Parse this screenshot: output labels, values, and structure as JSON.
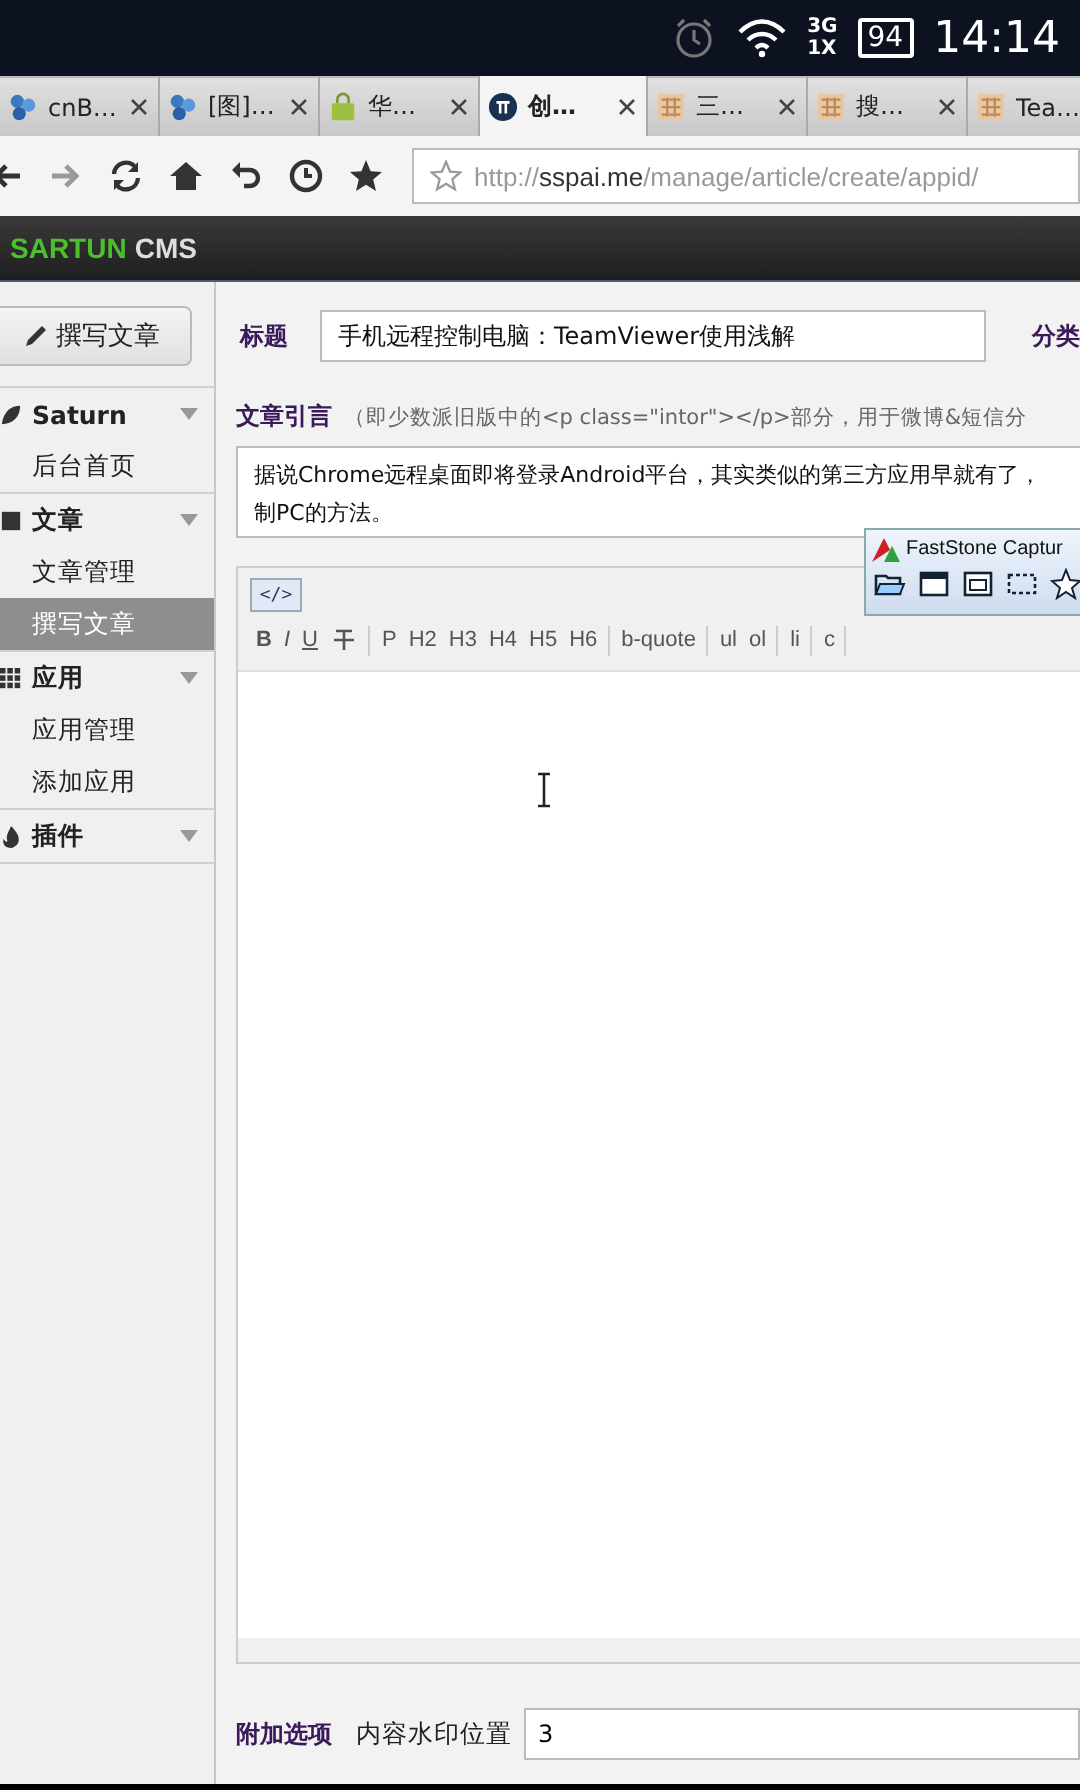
{
  "status_bar": {
    "network": [
      "3G",
      "1X"
    ],
    "battery": "94",
    "time": "14:14"
  },
  "browser": {
    "tabs": [
      {
        "title": "cnB…",
        "kind": "cluster",
        "selected": false
      },
      {
        "title": "[图]…",
        "kind": "cluster",
        "selected": false
      },
      {
        "title": "华…",
        "kind": "bag",
        "selected": false
      },
      {
        "title": "创…",
        "kind": "pi",
        "selected": true
      },
      {
        "title": "三…",
        "kind": "tile",
        "selected": false
      },
      {
        "title": "搜…",
        "kind": "tile",
        "selected": false
      },
      {
        "title": "Tea…",
        "kind": "tile",
        "selected": false
      }
    ],
    "url": "http://**sspai.me**/manage/article/create/appid/"
  },
  "cms": {
    "brand": "SARTUN",
    "product": "CMS"
  },
  "sidebar": {
    "compose_button": "撰写文章",
    "groups": [
      {
        "label": "Saturn",
        "kind": "leaf",
        "items": [
          {
            "label": "后台首页",
            "selected": false
          }
        ]
      },
      {
        "label": "文章",
        "kind": "book",
        "items": [
          {
            "label": "文章管理",
            "selected": false
          },
          {
            "label": "撰写文章",
            "selected": true
          }
        ]
      },
      {
        "label": "应用",
        "kind": "grid",
        "items": [
          {
            "label": "应用管理",
            "selected": false
          },
          {
            "label": "添加应用",
            "selected": false
          }
        ]
      },
      {
        "label": "插件",
        "kind": "fire"
      }
    ]
  },
  "form": {
    "title_label": "标题",
    "title_value": "手机远程控制电脑：TeamViewer使用浅解",
    "category_label": "分类",
    "intro_label": "文章引言",
    "intro_hint": "（即少数派旧版中的<p class=\"intor\"></p>部分，用于微博&短信分",
    "intro_lines": [
      "据说Chrome远程桌面即将登录Android平台，其实类似的第三方应用早就有了，",
      "制PC的方法。"
    ],
    "editor": {
      "source_button": "</>",
      "button_groups": [
        [
          {
            "label": "B",
            "kind": "bold"
          },
          {
            "label": "I",
            "kind": "italic"
          },
          {
            "label": "U",
            "kind": "underline"
          },
          {
            "kind": "strike"
          }
        ],
        [
          {
            "label": "P",
            "kind": "text"
          },
          {
            "label": "H2",
            "kind": "text"
          },
          {
            "label": "H3",
            "kind": "text"
          },
          {
            "label": "H4",
            "kind": "text"
          },
          {
            "label": "H5",
            "kind": "text"
          },
          {
            "label": "H6",
            "kind": "text"
          }
        ],
        [
          {
            "label": "b-quote",
            "kind": "text"
          }
        ],
        [
          {
            "label": "ul",
            "kind": "text"
          },
          {
            "label": "ol",
            "kind": "text"
          }
        ],
        [
          {
            "label": "li",
            "kind": "text"
          }
        ],
        [
          {
            "label": "c",
            "kind": "text"
          }
        ]
      ]
    },
    "options_label": "附加选项",
    "watermark_label": "内容水印位置",
    "watermark_value": "3"
  },
  "overlay": {
    "title": "FastStone Captur"
  }
}
